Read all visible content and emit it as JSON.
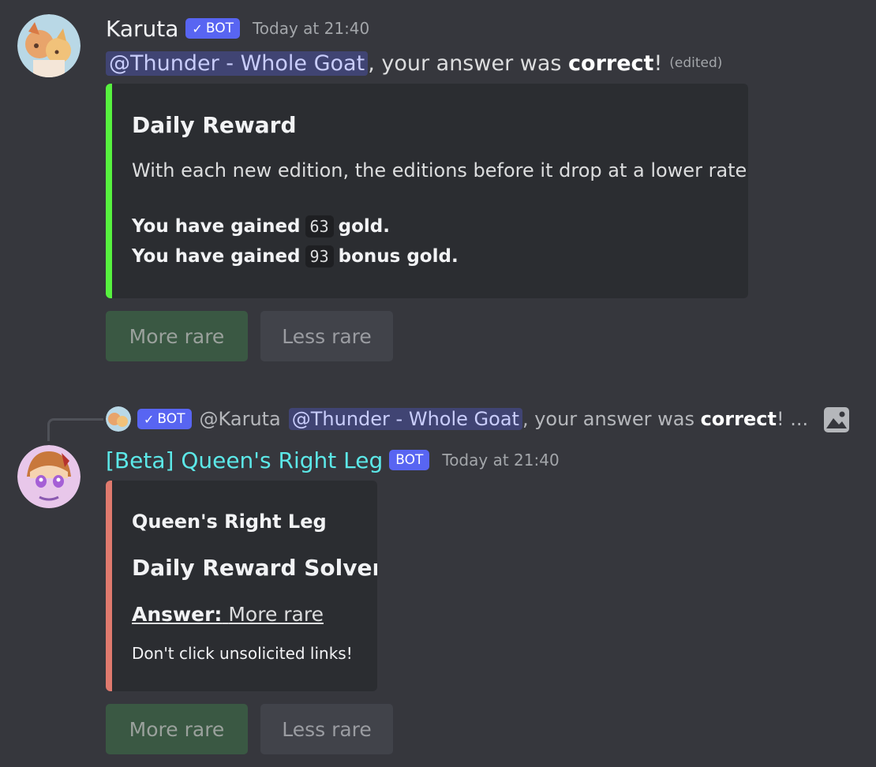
{
  "message1": {
    "author": "Karuta",
    "bot_tag": "BOT",
    "timestamp": "Today at 21:40",
    "mention": "@Thunder - Whole Goat",
    "text_before_bold": ", your answer was ",
    "bold_text": "correct",
    "text_after_bold": "!",
    "edited_label": "(edited)",
    "embed": {
      "bar_color": "#57f23f",
      "title": "Daily Reward",
      "description": "With each new edition, the editions before it drop at a lower rate.",
      "gold_line_1_before": "You have gained",
      "gold_line_1_value": "63",
      "gold_line_1_after": "gold.",
      "gold_line_2_before": "You have gained",
      "gold_line_2_value": "93",
      "gold_line_2_after": "bonus gold."
    },
    "buttons": {
      "more_rare": "More rare",
      "less_rare": "Less rare"
    }
  },
  "reply_reference": {
    "bot_tag": "BOT",
    "author_mention": "@Karuta",
    "mention": "@Thunder - Whole Goat",
    "text_before_bold": ", your answer was ",
    "bold_text": "correct",
    "text_after_bold": "! ..."
  },
  "message2": {
    "author": "[Beta] Queen's Right Leg",
    "bot_tag": "BOT",
    "timestamp": "Today at 21:40",
    "embed": {
      "bar_color": "#e07a6e",
      "author_name": "Queen's Right Leg",
      "title": "Daily Reward Solver",
      "answer_label": "Answer:",
      "answer_value": "More rare",
      "footer_text": "Don't click unsolicited links!"
    },
    "buttons": {
      "more_rare": "More rare",
      "less_rare": "Less rare"
    }
  },
  "colors": {
    "background": "#36373d",
    "embed_background": "#2b2d31",
    "bot_tag": "#5865f2",
    "button_green": "#3a5843",
    "button_grey": "#41434a"
  },
  "icons": {
    "verified": "check-icon",
    "image": "image-icon"
  }
}
